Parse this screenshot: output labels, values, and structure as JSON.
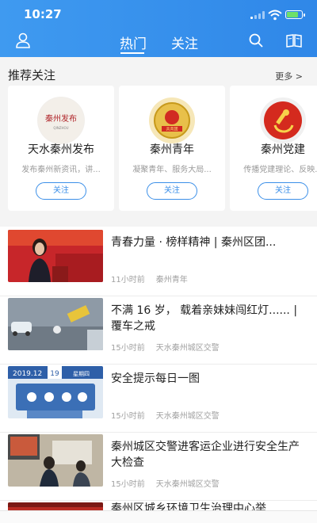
{
  "status_bar": {
    "time": "10:27"
  },
  "header": {
    "tabs": [
      {
        "label": "热门",
        "active": true
      },
      {
        "label": "关注",
        "active": false
      }
    ],
    "icons": [
      "user-icon",
      "search-icon",
      "book-icon"
    ]
  },
  "recommend": {
    "title": "推荐关注",
    "more_label": "更多 >",
    "cards": [
      {
        "name": "天水秦州发布",
        "desc": "发布秦州新资讯，讲...",
        "follow": "关注",
        "logo_text": "秦州发布"
      },
      {
        "name": "秦州青年",
        "desc": "凝聚青年、服务大局...",
        "follow": "关注",
        "logo_text": "共青团"
      },
      {
        "name": "秦州党建",
        "desc": "传播党建理论、反映...",
        "follow": "关注",
        "logo_text": ""
      }
    ]
  },
  "news": [
    {
      "title": "青春力量 · 榜样精神 | 秦州区团...",
      "time": "11小时前",
      "source": "秦州青年"
    },
    {
      "title": "不满 16 岁， 载着亲妹妹闯红灯...... | 覆车之戒",
      "time": "15小时前",
      "source": "天水秦州城区交警"
    },
    {
      "title": "安全提示每日一图",
      "time": "15小时前",
      "source": "天水秦州城区交警",
      "thumb_date": "2019.12",
      "thumb_day": "19",
      "thumb_week": "星期四"
    },
    {
      "title": "秦州城区交警进客运企业进行安全生产大检查",
      "time": "15小时前",
      "source": "天水秦州城区交警"
    },
    {
      "title": "秦州区城乡环境卫生治理中心举",
      "time": "",
      "source": ""
    }
  ],
  "colors": {
    "header": "#3b8fe8",
    "accent": "#3b8fe8",
    "party_red": "#d42a1e"
  }
}
